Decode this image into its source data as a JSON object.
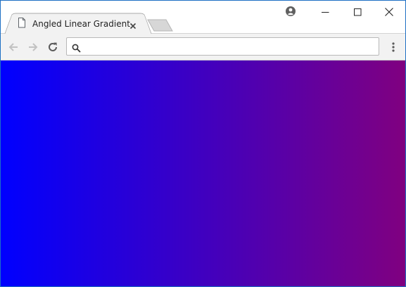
{
  "tab": {
    "title": "Angled Linear Gradient"
  },
  "toolbar": {
    "omnibox_value": "",
    "omnibox_placeholder": ""
  },
  "content": {
    "gradient_start_color": "#0000ff",
    "gradient_end_color": "#800080"
  },
  "colors": {
    "window_border": "#1e6fc4",
    "toolbar_bg": "#f2f2f2"
  },
  "icons": {
    "tab": [
      "document-icon",
      "close-icon"
    ],
    "window_controls": [
      "profile-icon",
      "minimize-icon",
      "maximize-icon",
      "close-icon"
    ],
    "toolbar": [
      "back-arrow-icon",
      "forward-arrow-icon",
      "reload-icon",
      "search-icon",
      "menu-kebab-icon"
    ]
  }
}
